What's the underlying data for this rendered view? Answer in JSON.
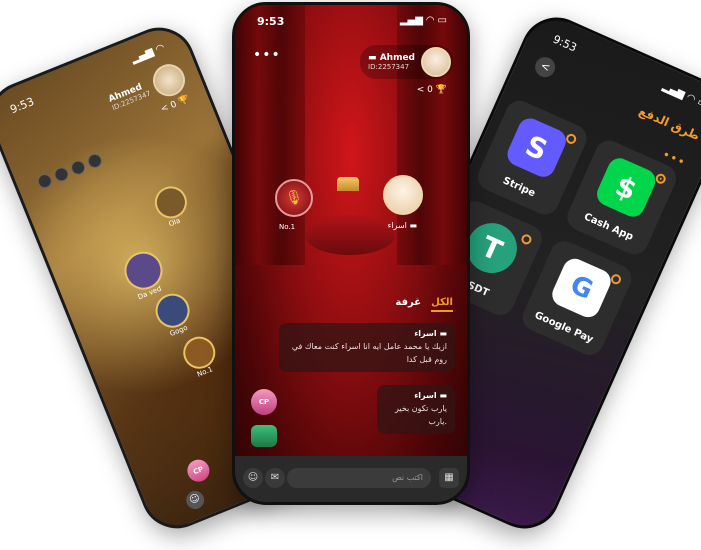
{
  "left_phone": {
    "time": "9:53",
    "user_name": "Ahmed",
    "user_id": "ID:2257347",
    "trophy_count": "0",
    "seat_labels": [
      "Ola",
      "Da ved",
      "Gogo",
      "No.1"
    ],
    "badge_text": "CP"
  },
  "center_phone": {
    "time": "9:53",
    "more": "•••",
    "user_name": "Ahmed",
    "user_id": "ID:2257347",
    "trophy_count": "0",
    "seat_mic_label": "No.1",
    "seat_user_label": "اسراء",
    "tabs": [
      "الكل",
      "غرفة"
    ],
    "messages": [
      {
        "name": "اسراء",
        "text": "ازيك يا محمد عامل ايه انا اسراء كنت معاك في روم قبل كدا"
      },
      {
        "name": "اسراء",
        "text": "يارب تكون بخير يارب."
      }
    ],
    "badge_cp": "CP",
    "input_placeholder": "اكتب نص"
  },
  "right_phone": {
    "time": "9:53",
    "title": "طرق الدفع",
    "back": "<",
    "more": "•••",
    "methods": [
      {
        "name": "Stripe",
        "logo": "S",
        "color": "#635bff"
      },
      {
        "name": "Cash App",
        "logo": "$",
        "color": "#00d54b"
      },
      {
        "name": "Google Pay",
        "logo": "G",
        "color": "#ffffff"
      },
      {
        "name": "USDT",
        "logo": "T",
        "color": "#26a17b"
      }
    ],
    "selected_method": "Cash App"
  },
  "colors": {
    "accent": "#f29a2a",
    "room_red": "#8d0d10"
  }
}
